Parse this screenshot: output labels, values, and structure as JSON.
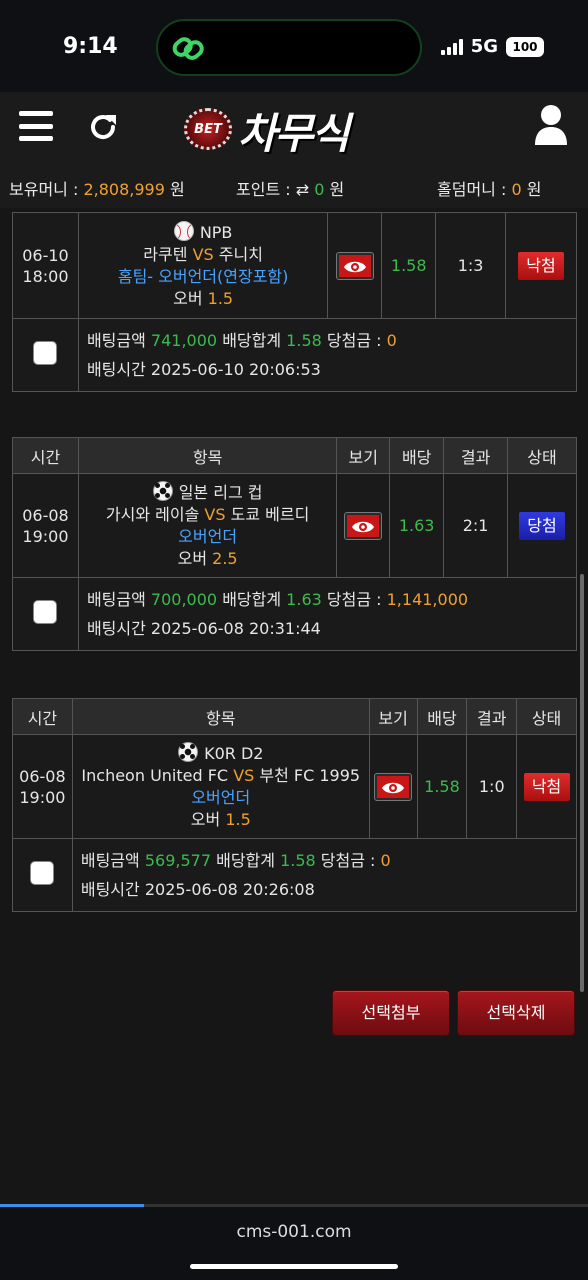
{
  "status_bar": {
    "time": "9:14",
    "network": "5G",
    "battery": "100"
  },
  "header": {
    "logo_badge": "BET",
    "logo_text": "차무식",
    "icons": [
      "menu-icon",
      "refresh-icon",
      "user-icon"
    ]
  },
  "info_bar": {
    "money_label": "보유머니 :",
    "money_value": "2,808,999",
    "money_unit": "원",
    "point_label": "포인트 :",
    "point_value": "0",
    "point_unit": "원",
    "holdem_label": "홀덤머니 :",
    "holdem_value": "0",
    "holdem_unit": "원"
  },
  "table_headers": {
    "time": "시간",
    "item": "항목",
    "view": "보기",
    "odds": "배당",
    "result": "결과",
    "status": "상태"
  },
  "labels": {
    "vs": "VS",
    "bet_amount": "배팅금액",
    "odds_total": "배당합계",
    "win_amount": "당첨금 :",
    "bet_time": "배팅시간"
  },
  "bets": [
    {
      "date": "06-10",
      "time": "18:00",
      "league": "NPB",
      "home": "라쿠텐",
      "away": "주니치",
      "market": "홈팀- 오버언더(연장포함)",
      "pick": "오버",
      "line": "1.5",
      "odds": "1.58",
      "result": "1:3",
      "status": "낙첨",
      "bet_amount": "741,000",
      "odds_total": "1.58",
      "win_amount": "0",
      "bet_time": "2025-06-10 20:06:53"
    },
    {
      "date": "06-08",
      "time": "19:00",
      "league": "일본 리그 컵",
      "home": "가시와 레이솔",
      "away": "도쿄 베르디",
      "market": "오버언더",
      "pick": "오버",
      "line": "2.5",
      "odds": "1.63",
      "result": "2:1",
      "status": "당첨",
      "bet_amount": "700,000",
      "odds_total": "1.63",
      "win_amount": "1,141,000",
      "bet_time": "2025-06-08 20:31:44"
    },
    {
      "date": "06-08",
      "time": "19:00",
      "league": "K0R D2",
      "home": "Incheon United FC",
      "away": "부천 FC 1995",
      "market": "오버언더",
      "pick": "오버",
      "line": "1.5",
      "odds": "1.58",
      "result": "1:0",
      "status": "낙첨",
      "bet_amount": "569,577",
      "odds_total": "1.58",
      "win_amount": "0",
      "bet_time": "2025-06-08 20:26:08"
    }
  ],
  "actions": {
    "attach": "선택첨부",
    "delete": "선택삭제"
  },
  "footer": {
    "url": "cms-001.com",
    "page_load_progress": 0.245
  },
  "colors": {
    "accent_orange": "#f0a030",
    "accent_green": "#3cba4c",
    "accent_blue": "#4aa3ff",
    "lose_red": "#c91616",
    "win_blue": "#2f3ae0"
  }
}
